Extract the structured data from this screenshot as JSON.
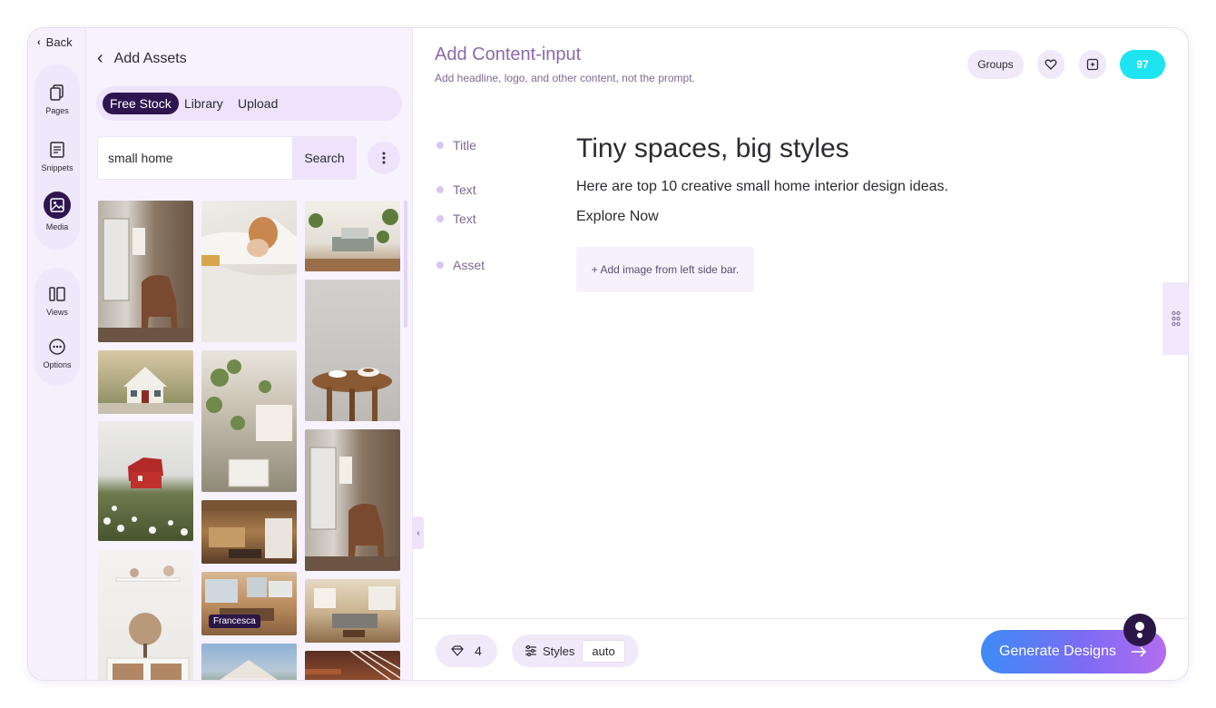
{
  "rail": {
    "back_label": "Back",
    "items": [
      {
        "label": "Pages",
        "icon": "pages-icon"
      },
      {
        "label": "Snippets",
        "icon": "snippets-icon"
      },
      {
        "label": "Media",
        "icon": "media-icon"
      },
      {
        "label": "Views",
        "icon": "views-icon"
      },
      {
        "label": "Options",
        "icon": "options-icon"
      }
    ]
  },
  "assets": {
    "title": "Add Assets",
    "tabs": [
      "Free Stock",
      "Library",
      "Upload"
    ],
    "active_tab": "Free Stock",
    "search": {
      "value": "small home",
      "button_label": "Search"
    },
    "photo_credit": "Francesca"
  },
  "main": {
    "title": "Add Content-input",
    "subtitle": "Add headline, logo, and other content, not the prompt.",
    "groups_label": "Groups",
    "credits": "97",
    "fields": [
      {
        "label": "Title",
        "value": "Tiny spaces, big styles"
      },
      {
        "label": "Text",
        "value": "Here are top 10 creative small home interior design ideas."
      },
      {
        "label": "Text",
        "value": "Explore Now"
      },
      {
        "label": "Asset",
        "value": "+ Add image from left side bar."
      }
    ]
  },
  "footer": {
    "count": "4",
    "styles_label": "Styles",
    "styles_value": "auto",
    "generate_label": "Generate Designs"
  },
  "colors": {
    "accent_dark": "#2f1550",
    "credits_badge": "#1de4f0",
    "generate_gradient_start": "#3d8bf5",
    "generate_gradient_end": "#b46cf0"
  }
}
